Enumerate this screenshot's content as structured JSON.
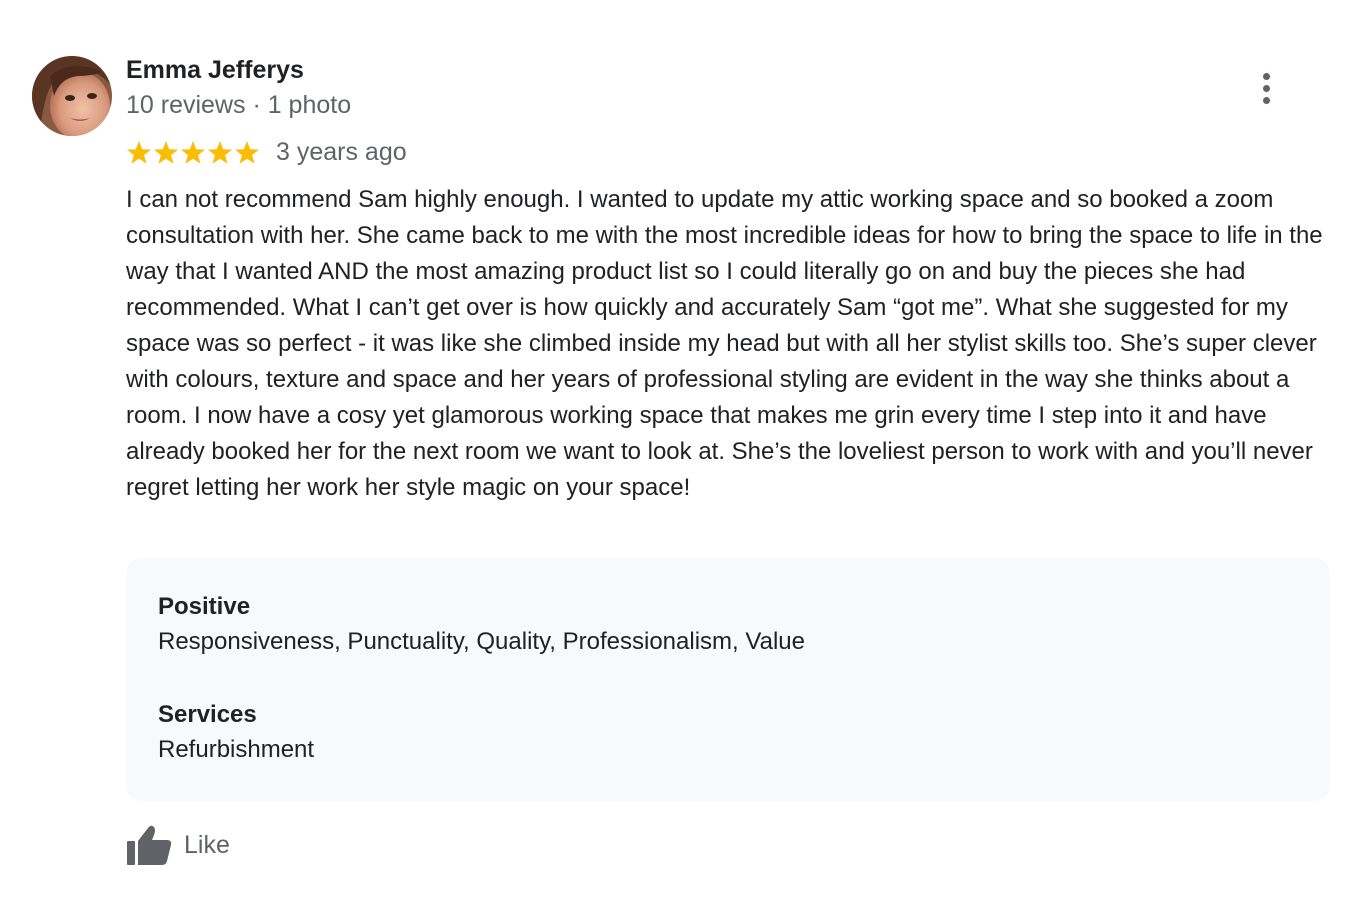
{
  "author": {
    "name": "Emma Jefferys",
    "meta": "10 reviews · 1 photo",
    "avatar_icon": "profile-photo"
  },
  "rating": {
    "stars": 5,
    "max_stars": 5,
    "star_color": "#fbbc04",
    "date": "3 years ago"
  },
  "review": {
    "text": "I can not recommend Sam highly enough. I wanted to update my attic working space and so booked a zoom consultation with her. She came back to me with the most incredible ideas for how to bring the space to life in the way that I wanted AND the most amazing product list so I could literally go on and buy the pieces she had recommended. What I can’t get over is how quickly and accurately Sam “got me”. What she suggested for my space was so perfect - it was like she climbed inside my head but with all her stylist skills too. She’s super clever with colours, texture and space and her years of professional styling are evident in the way she thinks about a room. I now have a cosy yet glamorous working space that makes me grin every time I step into it and have already booked her for the next room we want to look at. She’s the loveliest person to work with and you’ll never regret letting her work her style magic on your space!"
  },
  "attributes": [
    {
      "label": "Positive",
      "value": "Responsiveness, Punctuality, Quality, Professionalism, Value"
    },
    {
      "label": "Services",
      "value": "Refurbishment"
    }
  ],
  "actions": {
    "more_icon": "more-vert-icon",
    "like_icon": "thumbs-up-icon",
    "like_label": "Like"
  },
  "colors": {
    "primary_text": "#202124",
    "secondary_text": "#5f6368",
    "panel_background": "#f8f9fa",
    "star": "#fbbc04"
  }
}
